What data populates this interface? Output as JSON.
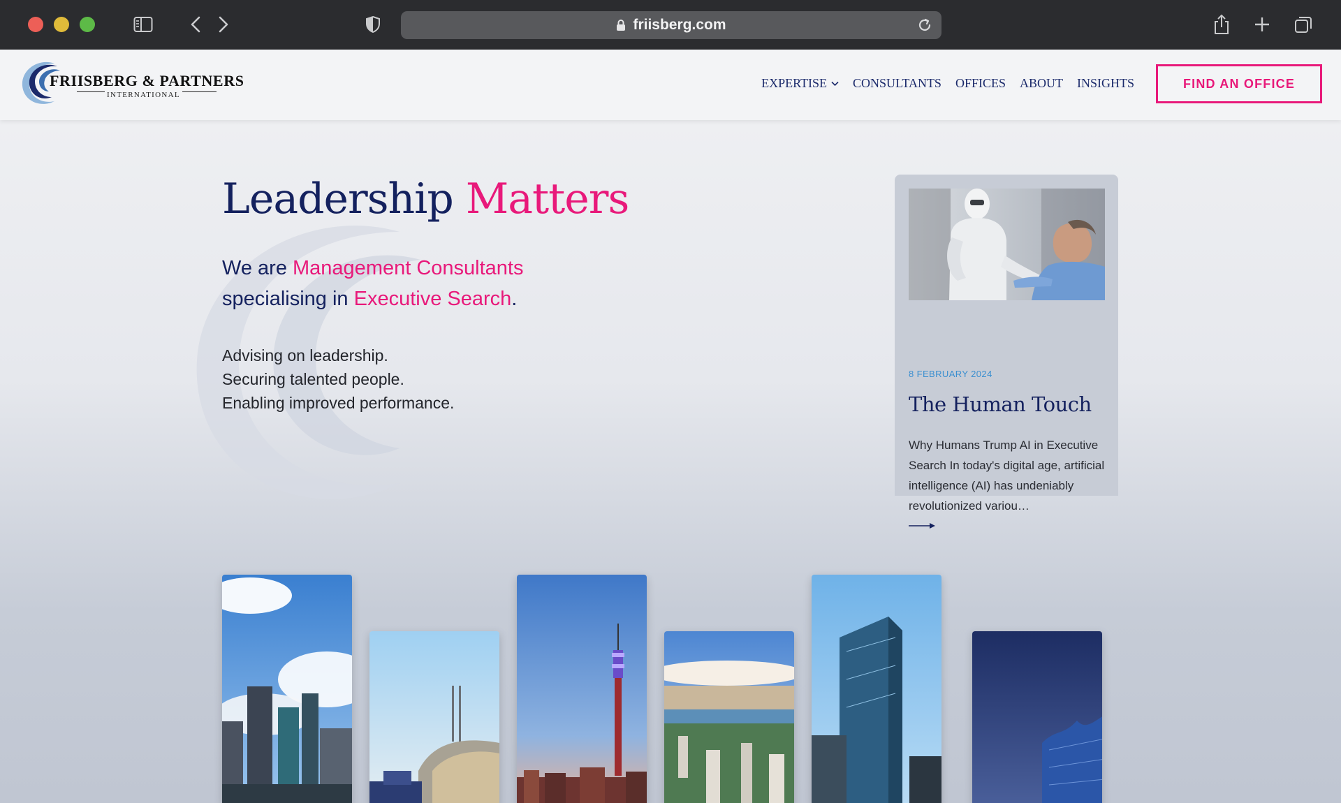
{
  "browser": {
    "url": "friisberg.com",
    "icons": [
      "sidebar-icon",
      "back-icon",
      "forward-icon",
      "privacy-shield-icon",
      "lock-icon",
      "reload-icon",
      "share-icon",
      "new-tab-icon",
      "tab-overview-icon"
    ]
  },
  "header": {
    "logo_name": "FRIISBERG & PARTNERS",
    "logo_sub": "INTERNATIONAL",
    "nav": [
      {
        "label": "EXPERTISE"
      },
      {
        "label": "CONSULTANTS"
      },
      {
        "label": "OFFICES"
      },
      {
        "label": "ABOUT"
      },
      {
        "label": "INSIGHTS"
      }
    ],
    "cta": "FIND AN OFFICE"
  },
  "hero": {
    "headline_part1": "Leadership",
    "headline_part2": "Matters",
    "sub_we_are": "We are",
    "sub_management": "Management Consultants",
    "sub_specialising": "specialising in",
    "sub_executive": "Executive Search",
    "sub_period": ".",
    "line1": "Advising on leadership.",
    "line2": "Securing talented people.",
    "line3": "Enabling improved performance."
  },
  "insight_card": {
    "date": "8 FEBRUARY 2024",
    "title": "The Human Touch",
    "excerpt": "Why Humans Trump AI in Executive Search In today's digital age, artificial intelligence (AI) has undeniably revolutionized variou…"
  },
  "colors": {
    "navy": "#14215e",
    "pink": "#e8197a",
    "date_blue": "#3b8fd0",
    "chrome": "#2b2c2f"
  }
}
